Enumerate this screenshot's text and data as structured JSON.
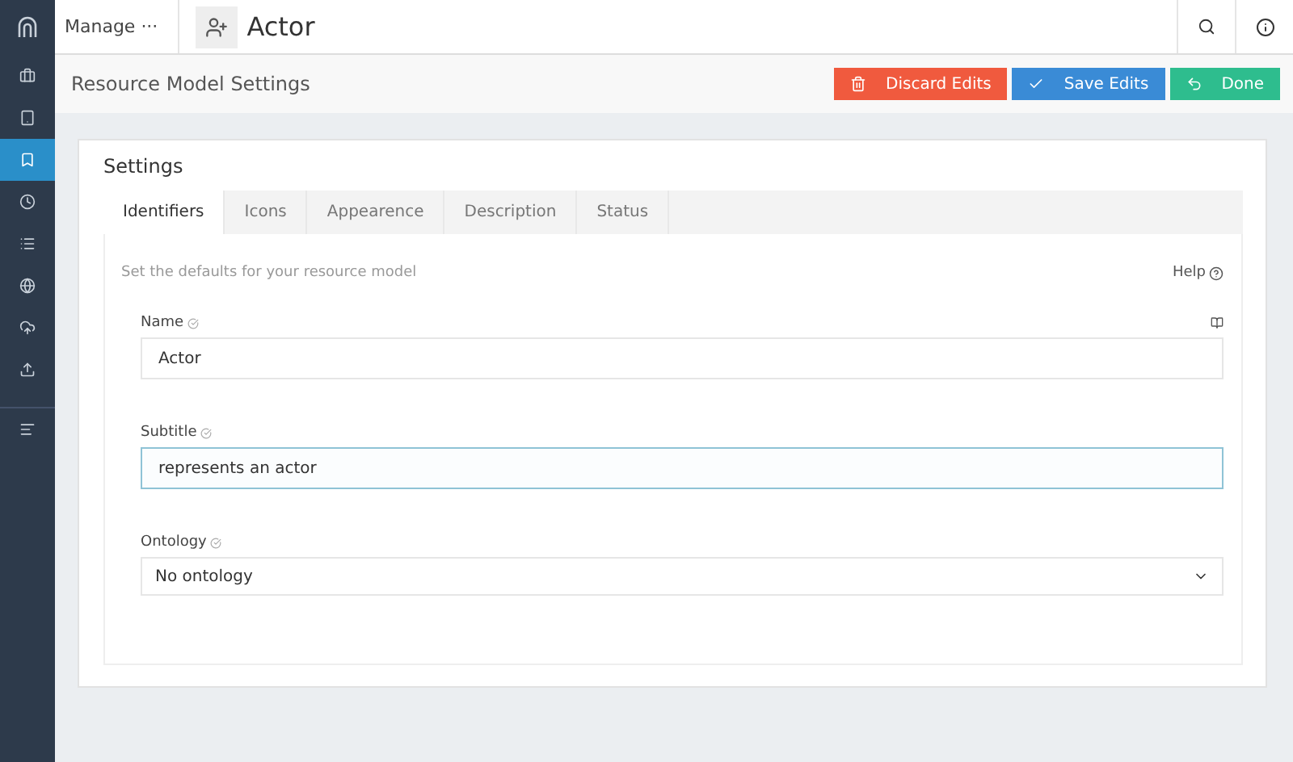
{
  "sidebar": {
    "items": [
      {
        "selected": false
      },
      {
        "selected": false
      },
      {
        "selected": true
      },
      {
        "selected": false
      },
      {
        "selected": false
      },
      {
        "selected": false
      },
      {
        "selected": false
      },
      {
        "selected": false
      },
      {
        "selected": false
      }
    ]
  },
  "topbar": {
    "menu": "Manage ···",
    "title": "Actor"
  },
  "subheader": {
    "title": "Resource Model Settings",
    "buttons": [
      {
        "label": "Discard Edits",
        "kind": "discard"
      },
      {
        "label": "Save Edits",
        "kind": "save"
      },
      {
        "label": "Done",
        "kind": "done"
      }
    ]
  },
  "card": {
    "title": "Settings",
    "tabs": [
      {
        "label": "Identifiers",
        "selected": true
      },
      {
        "label": "Icons",
        "selected": false
      },
      {
        "label": "Appearence",
        "selected": false
      },
      {
        "label": "Description",
        "selected": false
      },
      {
        "label": "Status",
        "selected": false
      }
    ],
    "intro": "Set the defaults for your resource model",
    "help": "Help",
    "fields": [
      {
        "label": "Name",
        "kind": "text",
        "value": "Actor",
        "focused": false
      },
      {
        "label": "Subtitle",
        "kind": "text",
        "value": "represents an actor",
        "focused": true
      },
      {
        "label": "Ontology",
        "kind": "select",
        "value": "No ontology",
        "focused": false
      }
    ]
  }
}
